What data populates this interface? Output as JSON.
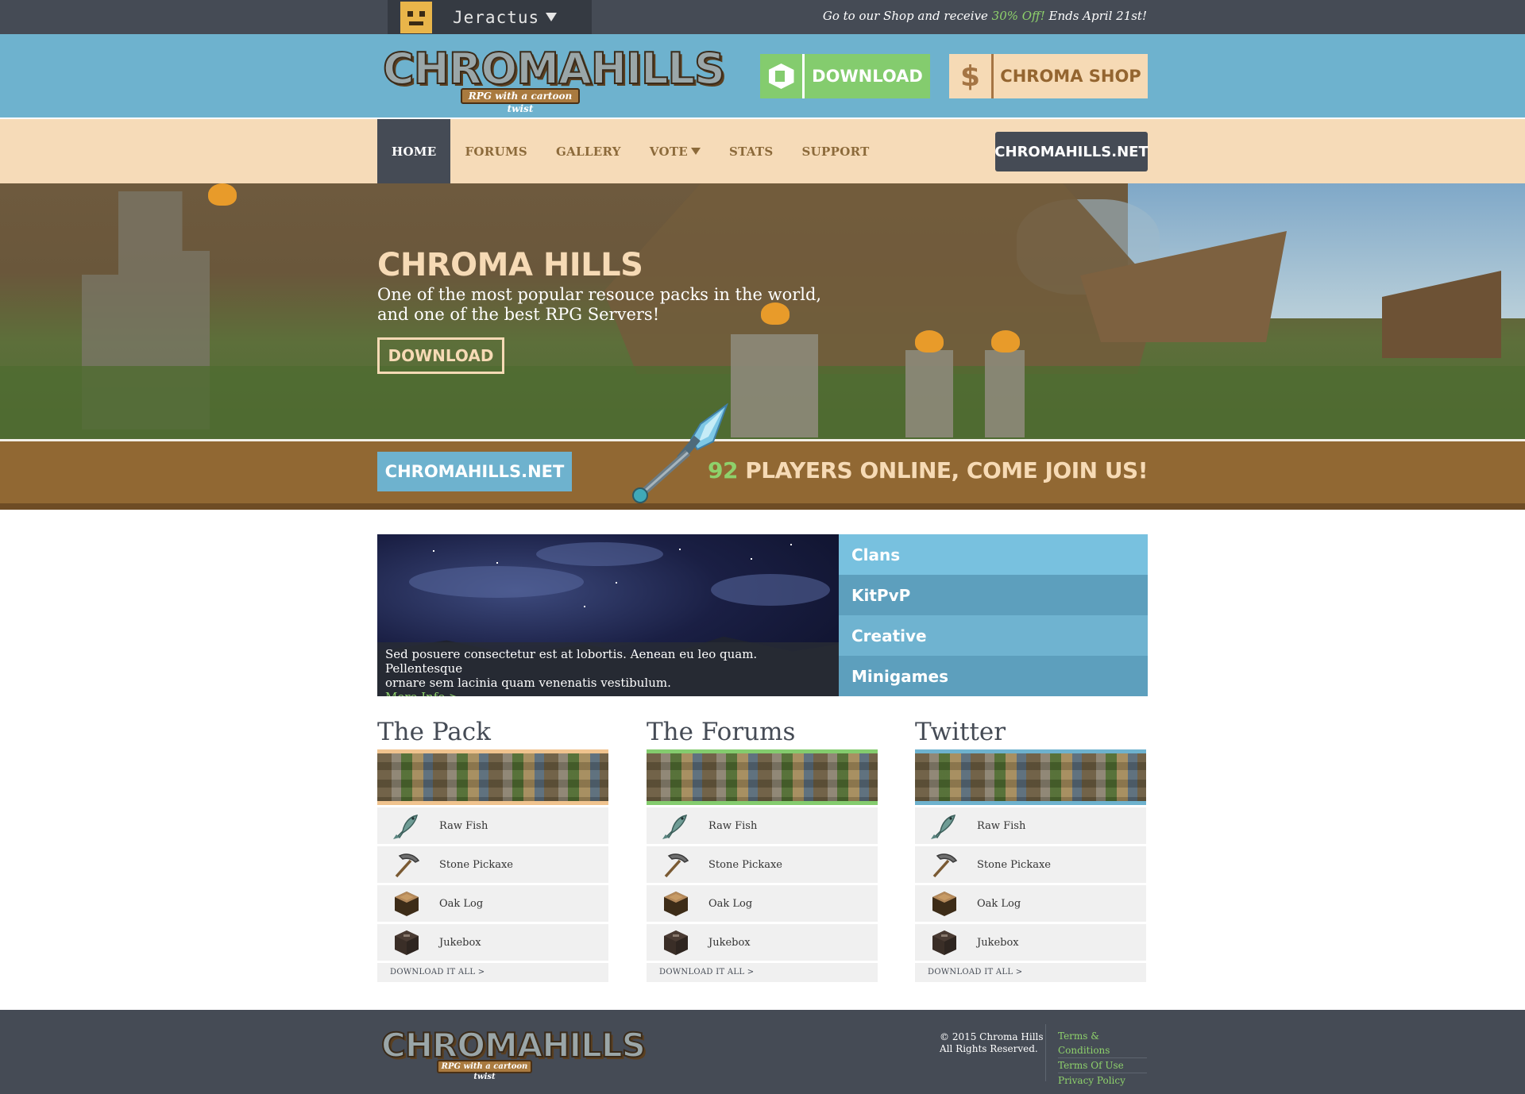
{
  "topbar": {
    "username": "Jeractus",
    "promo_prefix": "Go to our Shop and receive",
    "promo_highlight": "30% Off!",
    "promo_suffix": "Ends April 21st!"
  },
  "header": {
    "logo_text": "CHROMAHILLS",
    "logo_tagline": "RPG with a cartoon twist",
    "download_label": "DOWNLOAD",
    "shop_label": "CHROMA SHOP",
    "shop_icon": "$"
  },
  "nav": {
    "items": [
      "HOME",
      "FORUMS",
      "GALLERY",
      "VOTE",
      "STATS",
      "SUPPORT"
    ],
    "active": "HOME",
    "site_button": "CHROMAHILLS.NET"
  },
  "hero": {
    "title": "CHROMA HILLS",
    "subtitle_line1": "One of the most popular resouce packs in the world,",
    "subtitle_line2": "and one of the best RPG Servers!",
    "button": "DOWNLOAD"
  },
  "status": {
    "site_label": "CHROMAHILLS.NET",
    "player_count": "92",
    "players_text": "PLAYERS ONLINE, COME JOIN US!"
  },
  "feature": {
    "caption_line1": "Sed posuere consectetur est at lobortis. Aenean eu leo quam. Pellentesque",
    "caption_line2": "ornare sem lacinia quam venenatis vestibulum.",
    "link": "More Info >",
    "menu": [
      "Clans",
      "KitPvP",
      "Creative",
      "Minigames"
    ]
  },
  "columns": [
    {
      "title": "The Pack",
      "accent": "#f0c38e",
      "items": [
        {
          "label": "Raw Fish",
          "icon": "fish-icon"
        },
        {
          "label": "Stone Pickaxe",
          "icon": "pickaxe-icon"
        },
        {
          "label": "Oak Log",
          "icon": "log-icon"
        },
        {
          "label": "Jukebox",
          "icon": "jukebox-icon"
        }
      ],
      "footer": "DOWNLOAD IT ALL >"
    },
    {
      "title": "The Forums",
      "accent": "#84cc6e",
      "items": [
        {
          "label": "Raw Fish",
          "icon": "fish-icon"
        },
        {
          "label": "Stone Pickaxe",
          "icon": "pickaxe-icon"
        },
        {
          "label": "Oak Log",
          "icon": "log-icon"
        },
        {
          "label": "Jukebox",
          "icon": "jukebox-icon"
        }
      ],
      "footer": "DOWNLOAD IT ALL >"
    },
    {
      "title": "Twitter",
      "accent": "#6eb2ce",
      "items": [
        {
          "label": "Raw Fish",
          "icon": "fish-icon"
        },
        {
          "label": "Stone Pickaxe",
          "icon": "pickaxe-icon"
        },
        {
          "label": "Oak Log",
          "icon": "log-icon"
        },
        {
          "label": "Jukebox",
          "icon": "jukebox-icon"
        }
      ],
      "footer": "DOWNLOAD IT ALL >"
    }
  ],
  "footer": {
    "logo_text": "CHROMAHILLS",
    "logo_tagline": "RPG with a cartoon twist",
    "copyright_line1": "© 2015 Chroma Hills",
    "copyright_line2": "All Rights Reserved.",
    "links": [
      "Terms & Conditions",
      "Terms Of Use",
      "Privacy Policy"
    ]
  },
  "colors": {
    "dark": "#454b55",
    "sky_blue": "#6eb2ce",
    "cream": "#f6dab5",
    "green": "#84cc6e",
    "brown": "#916833"
  }
}
